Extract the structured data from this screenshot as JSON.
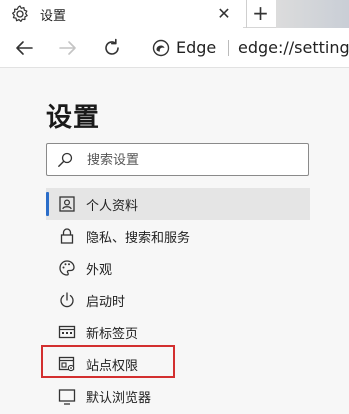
{
  "tab": {
    "title": "设置",
    "close_glyph": "✕",
    "gear_icon": "gear-icon"
  },
  "new_tab": {
    "glyph": "+"
  },
  "toolbar": {
    "back_icon": "back-arrow-icon",
    "forward_icon": "forward-arrow-icon",
    "refresh_icon": "refresh-icon",
    "brand_label": "Edge",
    "url": "edge://settings"
  },
  "page": {
    "title": "设置"
  },
  "search": {
    "placeholder": "搜索设置"
  },
  "nav": {
    "items": [
      {
        "label": "个人资料",
        "icon": "profile-icon",
        "selected": true
      },
      {
        "label": "隐私、搜索和服务",
        "icon": "lock-icon"
      },
      {
        "label": "外观",
        "icon": "palette-icon"
      },
      {
        "label": "启动时",
        "icon": "power-icon"
      },
      {
        "label": "新标签页",
        "icon": "new-tab-page-icon"
      },
      {
        "label": "站点权限",
        "icon": "site-permissions-icon",
        "highlighted": true
      },
      {
        "label": "默认浏览器",
        "icon": "default-browser-icon"
      }
    ]
  },
  "colors": {
    "accent": "#2b6dc9",
    "highlight_border": "#d32f2f"
  }
}
